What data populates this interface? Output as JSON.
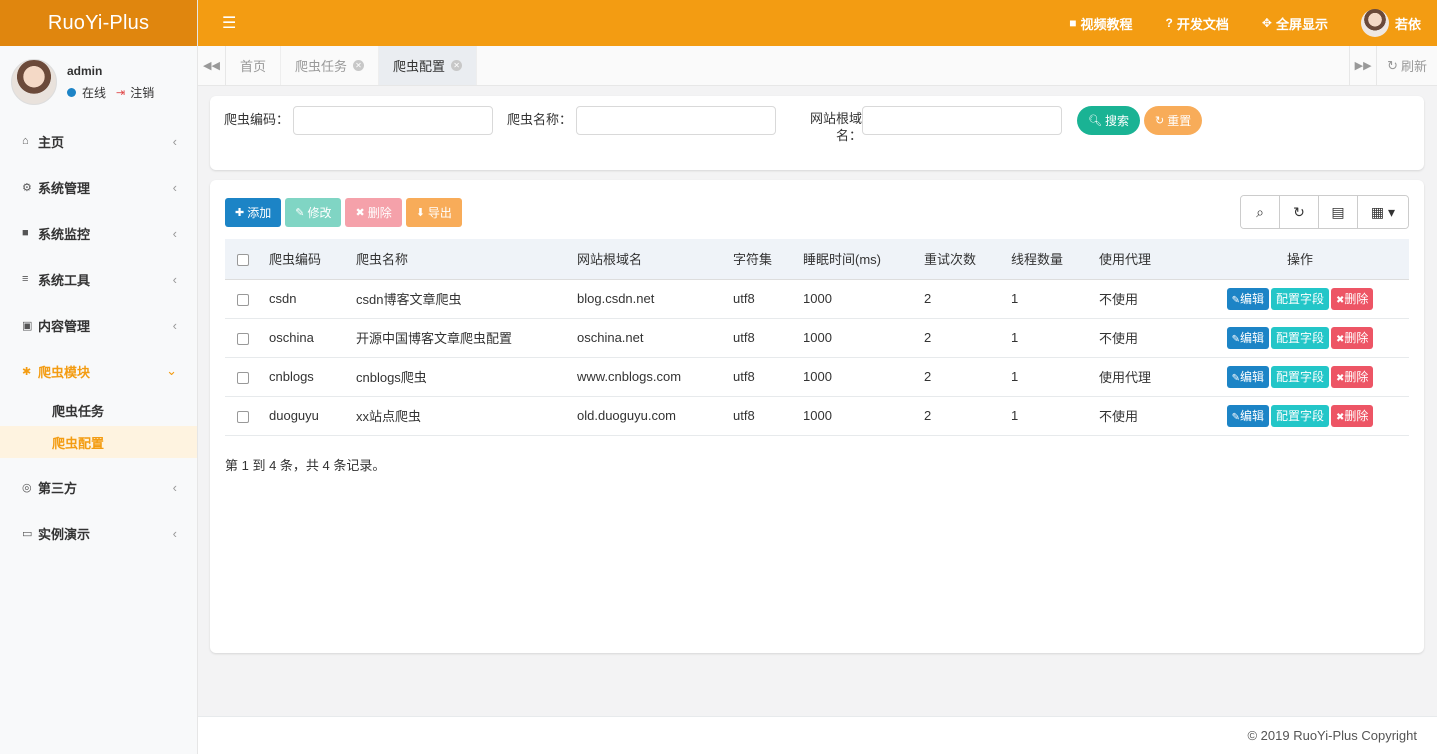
{
  "app": {
    "title": "RuoYi-Plus"
  },
  "user": {
    "name": "admin",
    "status": "在线",
    "logout": "注销"
  },
  "sidebar": {
    "items": [
      {
        "label": "主页",
        "icon": "home-icon"
      },
      {
        "label": "系统管理",
        "icon": "gear-icon"
      },
      {
        "label": "系统监控",
        "icon": "video-icon"
      },
      {
        "label": "系统工具",
        "icon": "bars-icon"
      },
      {
        "label": "内容管理",
        "icon": "card-icon"
      },
      {
        "label": "爬虫模块",
        "icon": "bug-icon"
      },
      {
        "label": "第三方",
        "icon": "lifering-icon"
      },
      {
        "label": "实例演示",
        "icon": "desktop-icon"
      }
    ],
    "submenu": [
      {
        "label": "爬虫任务"
      },
      {
        "label": "爬虫配置"
      }
    ]
  },
  "topbar": {
    "links": [
      {
        "label": "视频教程",
        "icon": "video-icon"
      },
      {
        "label": "开发文档",
        "icon": "question-icon"
      },
      {
        "label": "全屏显示",
        "icon": "fullscreen-icon"
      }
    ],
    "user": "若依"
  },
  "tabs": {
    "items": [
      {
        "label": "首页"
      },
      {
        "label": "爬虫任务"
      },
      {
        "label": "爬虫配置"
      }
    ],
    "refresh": "刷新"
  },
  "search": {
    "code_label": "爬虫编码：",
    "name_label": "爬虫名称：",
    "domain_label": "网站根域名：",
    "search_btn": "搜索",
    "reset_btn": "重置"
  },
  "toolbar": {
    "add": "添加",
    "edit": "修改",
    "delete": "删除",
    "export": "导出"
  },
  "table": {
    "columns": [
      "爬虫编码",
      "爬虫名称",
      "网站根域名",
      "字符集",
      "睡眠时间(ms)",
      "重试次数",
      "线程数量",
      "使用代理",
      "操作"
    ],
    "rows": [
      {
        "code": "csdn",
        "name": "csdn博客文章爬虫",
        "domain": "blog.csdn.net",
        "charset": "utf8",
        "sleep": "1000",
        "retry": "2",
        "threads": "1",
        "proxy": "不使用"
      },
      {
        "code": "oschina",
        "name": "开源中国博客文章爬虫配置",
        "domain": "oschina.net",
        "charset": "utf8",
        "sleep": "1000",
        "retry": "2",
        "threads": "1",
        "proxy": "不使用"
      },
      {
        "code": "cnblogs",
        "name": "cnblogs爬虫",
        "domain": "www.cnblogs.com",
        "charset": "utf8",
        "sleep": "1000",
        "retry": "2",
        "threads": "1",
        "proxy": "使用代理"
      },
      {
        "code": "duoguyu",
        "name": "xx站点爬虫",
        "domain": "old.duoguyu.com",
        "charset": "utf8",
        "sleep": "1000",
        "retry": "2",
        "threads": "1",
        "proxy": "不使用"
      }
    ],
    "actions": {
      "edit": "编辑",
      "config": "配置字段",
      "delete": "删除"
    },
    "summary": "第 1 到 4 条，共 4 条记录。"
  },
  "footer": {
    "copyright": "© 2019 RuoYi-Plus Copyright"
  },
  "colors": {
    "brand": "#f39c12",
    "brand_dark": "#e0860e",
    "primary": "#1c84c6",
    "success": "#1ab394",
    "danger": "#ed5565",
    "info": "#23c6c8",
    "warning": "#f8ac59"
  }
}
